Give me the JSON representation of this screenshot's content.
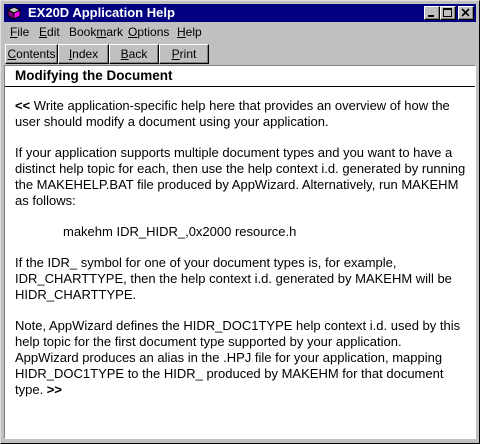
{
  "window": {
    "title": "EX20D Application Help",
    "icon": "help-book-icon",
    "controls": [
      "minimize-icon",
      "maximize-icon",
      "close-icon"
    ]
  },
  "menu": {
    "items": [
      {
        "first": "F",
        "rest": "ile"
      },
      {
        "first": "E",
        "rest": "dit"
      },
      {
        "pre": "Book",
        "u": "m",
        "post": "ark"
      },
      {
        "first": "O",
        "rest": "ptions"
      },
      {
        "first": "H",
        "rest": "elp"
      }
    ]
  },
  "toolbar": {
    "buttons": [
      {
        "first": "C",
        "rest": "ontents"
      },
      {
        "first": "I",
        "rest": "ndex"
      },
      {
        "first": "B",
        "rest": "ack"
      },
      {
        "first": "P",
        "rest": "rint"
      }
    ]
  },
  "topic": {
    "title": "Modifying the Document",
    "paragraphs": [
      {
        "marker": "<<",
        "text": " Write application-specific help here that provides an overview of how the user should modify a document using your application."
      },
      {
        "text": "If your application supports multiple document types and you want to have a distinct help topic for each, then use the help context i.d. generated by running the MAKEHELP.BAT file produced by AppWizard.  Alternatively, run MAKEHM as follows:"
      },
      {
        "text": "makehm IDR_HIDR_,0x2000 resource.h"
      },
      {
        "text": "If the IDR_ symbol for one of your document types is, for example, IDR_CHARTTYPE, then the help context i.d. generated by MAKEHM will be HIDR_CHARTTYPE."
      },
      {
        "text": "Note, AppWizard defines the HIDR_DOC1TYPE help context i.d. used by this help topic for the first document type supported by your application. AppWizard produces an alias in the .HPJ file for your application, mapping HIDR_DOC1TYPE to the HIDR_ produced by MAKEHM for that document type. ",
        "marker": ">>"
      }
    ]
  },
  "colors": {
    "titlebar": "#000080",
    "face": "#c0c0c0",
    "content_bg": "#ffffff"
  }
}
